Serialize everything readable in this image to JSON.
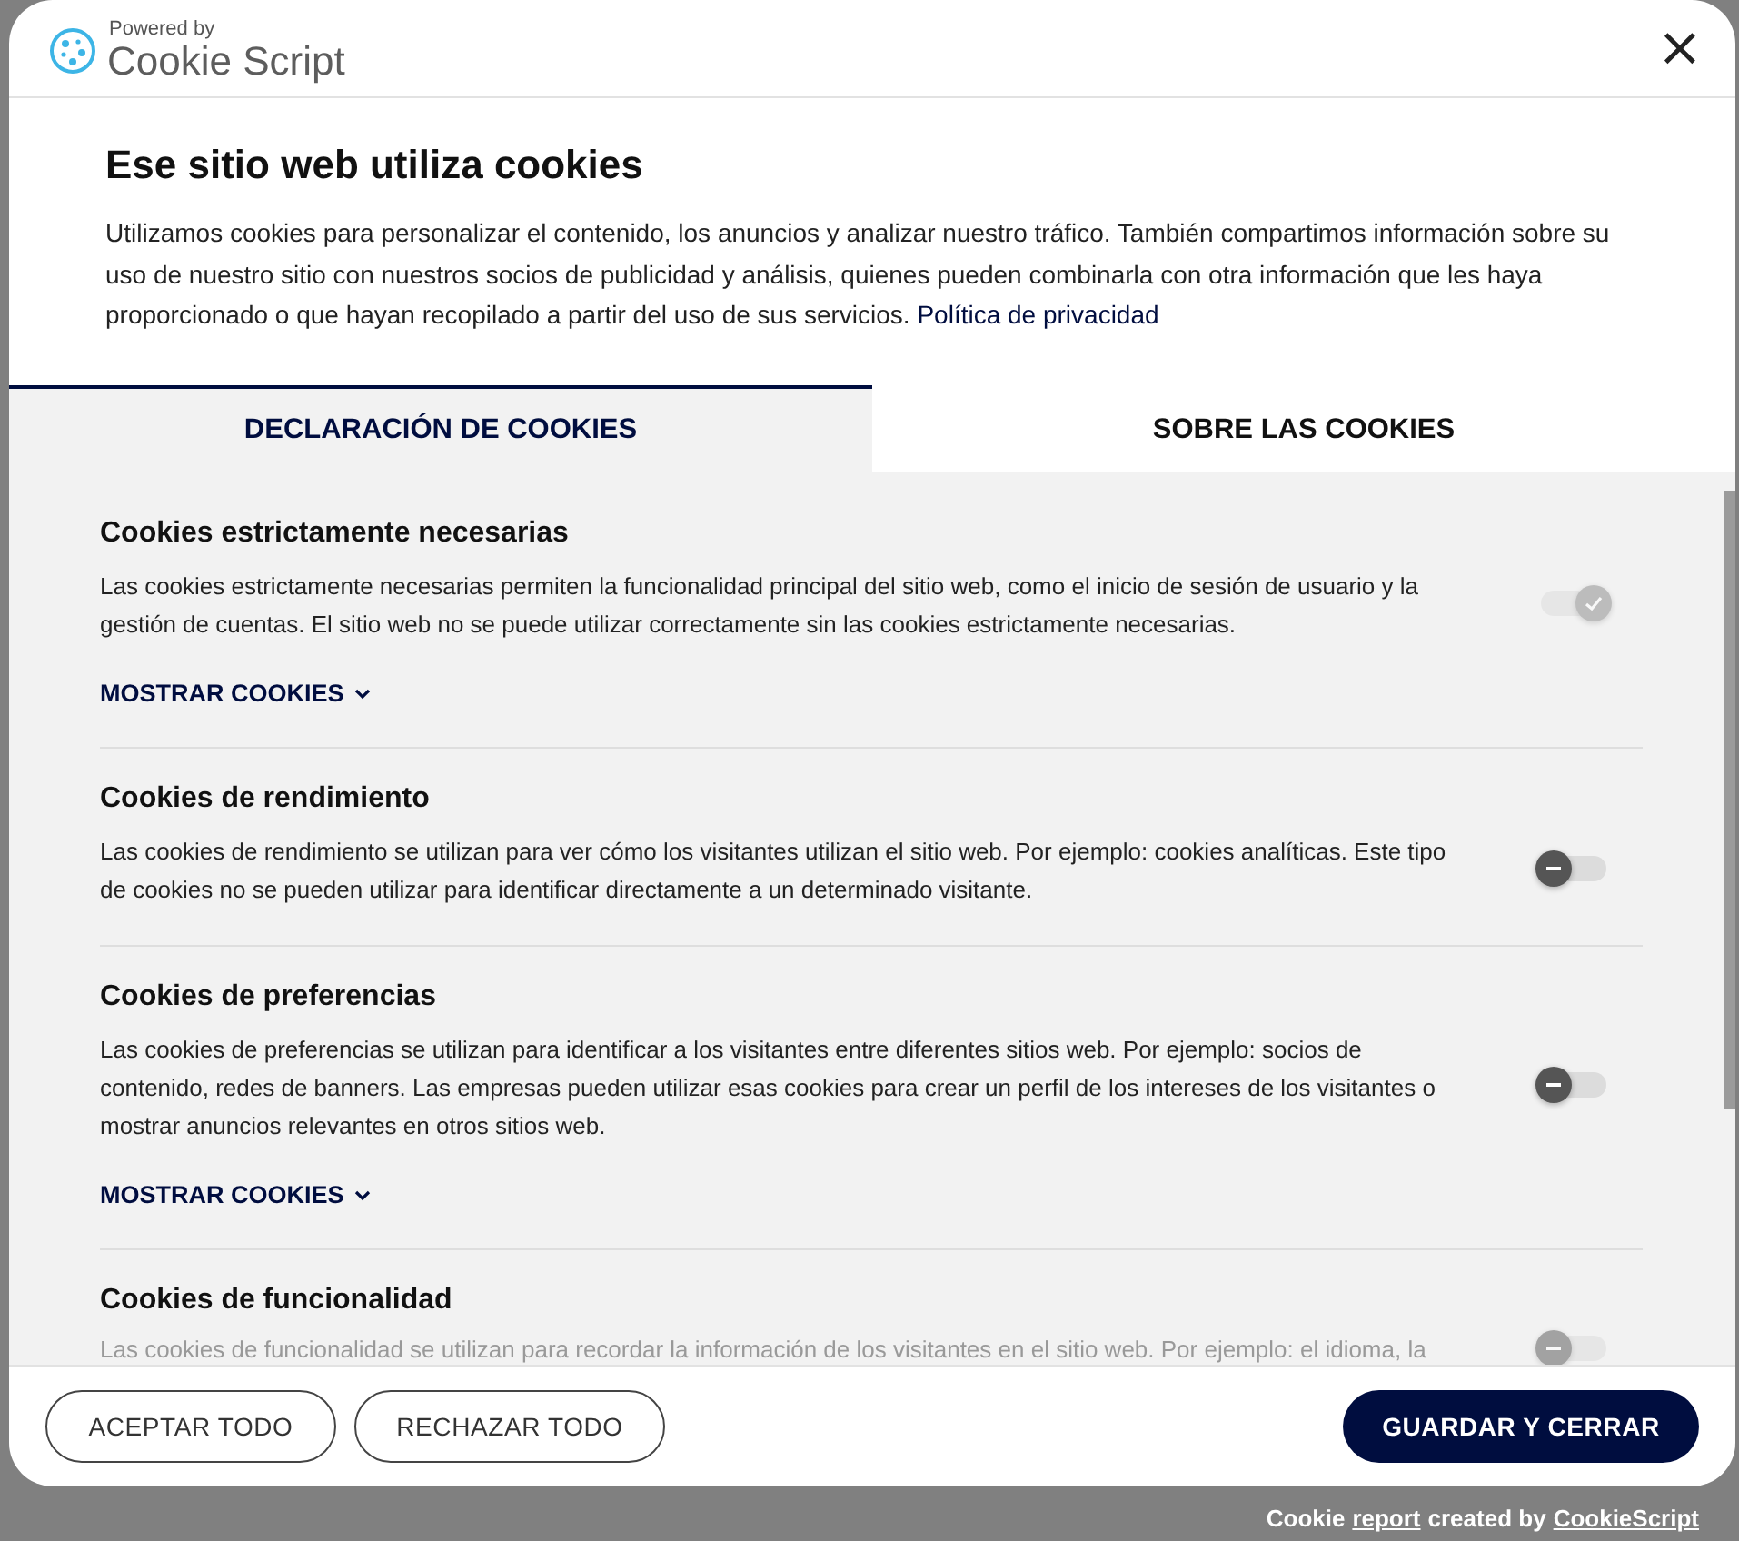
{
  "header": {
    "powered_by": "Powered by",
    "brand": "Cookie Script",
    "close": "×"
  },
  "intro": {
    "title": "Ese sitio web utiliza cookies",
    "text": "Utilizamos cookies para personalizar el contenido, los anuncios y analizar nuestro tráfico. También compartimos información sobre su uso de nuestro sitio con nuestros socios de publicidad y análisis, quienes pueden combinarla con otra información que les haya proporcionado o que hayan recopilado a partir del uso de sus servicios.",
    "link": "Política de privacidad"
  },
  "tabs": [
    {
      "label": "DECLARACIÓN DE COOKIES",
      "selected": true
    },
    {
      "label": "SOBRE LAS COOKIES",
      "selected": false
    }
  ],
  "categories": [
    {
      "title": "Cookies estrictamente necesarias",
      "text": "Las cookies estrictamente necesarias permiten la funcionalidad principal del sitio web, como el inicio de sesión de usuario y la gestión de cuentas. El sitio web no se puede utilizar correctamente sin las cookies estrictamente necesarias.",
      "checked": true,
      "disabled": true,
      "show_more": "MOSTRAR COOKIES"
    },
    {
      "title": "Cookies de rendimiento",
      "text": "Las cookies de rendimiento se utilizan para ver cómo los visitantes utilizan el sitio web. Por ejemplo: cookies analíticas. Este tipo de cookies no se pueden utilizar para identificar directamente a un determinado visitante.",
      "checked": false,
      "disabled": false
    },
    {
      "title": "Cookies de preferencias",
      "text": "Las cookies de preferencias se utilizan para identificar a los visitantes entre diferentes sitios web. Por ejemplo: socios de contenido, redes de banners. Las empresas pueden utilizar esas cookies para crear un perfil de los intereses de los visitantes o mostrar anuncios relevantes en otros sitios web.",
      "checked": false,
      "disabled": false,
      "show_more": "MOSTRAR COOKIES"
    },
    {
      "title": "Cookies de funcionalidad",
      "text": "Las cookies de funcionalidad se utilizan para recordar la información de los visitantes en el sitio web. Por ejemplo: el idioma, la",
      "checked": false,
      "disabled": false
    }
  ],
  "buttons": [
    {
      "label": "ACEPTAR TODO",
      "kind": "outline"
    },
    {
      "label": "RECHAZAR TODO",
      "kind": "outline"
    },
    {
      "label": "GUARDAR Y CERRAR",
      "kind": "primary"
    }
  ],
  "credit": {
    "prefix": "Cookie",
    "link": "report",
    "middle": "created by",
    "brand_link": "CookieScript"
  }
}
